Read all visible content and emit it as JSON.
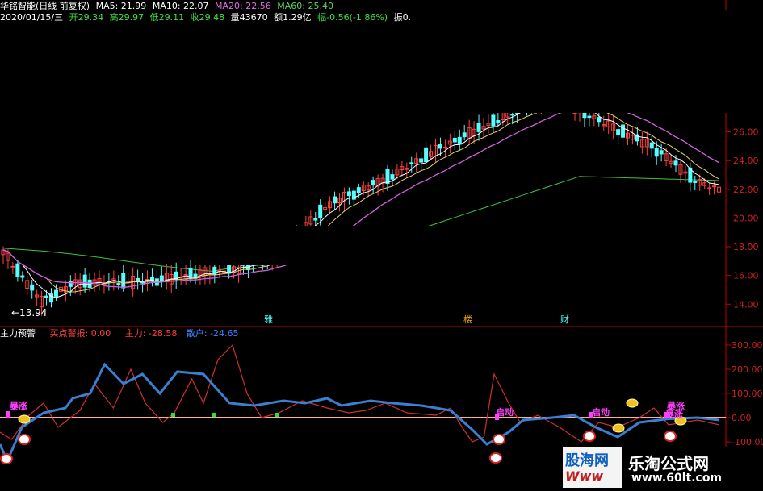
{
  "header": {
    "title": "华铭智能(日线 前复权)",
    "ma5": "MA5: 21.99",
    "ma10": "MA10: 22.07",
    "ma20": "MA20: 22.56",
    "ma60": "MA60: 25.40",
    "date": "2020/01/15/三",
    "open": "开29.34",
    "high": "高29.97",
    "low": "低29.11",
    "close": "收29.48",
    "volume": "量43670",
    "amount": "额1.29亿",
    "change": "幅-0.56(-1.86%)",
    "amplitude": "振0."
  },
  "price_axis": {
    "ticks": [
      "26.00",
      "24.00",
      "22.00",
      "20.00",
      "18.00",
      "16.00",
      "14.00"
    ]
  },
  "low_marker": "←13.94",
  "event_markers": [
    "雅",
    "楼",
    "财"
  ],
  "indicator": {
    "title": "主力预警",
    "buy_alert": "买点警报: 0.00",
    "main_force": "主力: -28.58",
    "retail": "散户: -24.65",
    "ticks": [
      "300.00",
      "200.00",
      "100.00",
      "0.00",
      "-100.00"
    ],
    "labels": [
      "暴涨",
      "启动",
      "启动",
      "暴涨",
      "暴涨"
    ]
  },
  "watermark": {
    "left_text": "股海网",
    "left_sub": "Www",
    "title": "乐淘公式网",
    "url": "www.60lt.com"
  },
  "colors": {
    "bg": "#000000",
    "up": "#ff4040",
    "down": "#54ffff",
    "ma5": "#ffffff",
    "ma10": "#e8d070",
    "ma20": "#d060e0",
    "ma60": "#40c040",
    "main_force": "#d03030",
    "retail": "#3a7fd0",
    "axis": "#c00000"
  },
  "chart_data": [
    {
      "type": "candlestick",
      "title": "华铭智能(日线 前复权)",
      "ylim": [
        13,
        28
      ],
      "y_ticks": [
        14,
        16,
        18,
        20,
        22,
        24,
        26
      ],
      "note_low": 13.94,
      "series": [
        {
          "name": "MA5",
          "last": 21.99
        },
        {
          "name": "MA10",
          "last": 22.07
        },
        {
          "name": "MA20",
          "last": 22.56
        },
        {
          "name": "MA60",
          "last": 25.4
        }
      ]
    },
    {
      "type": "line",
      "title": "主力预警",
      "ylim": [
        -150,
        330
      ],
      "y_ticks": [
        300,
        200,
        100,
        0,
        -100
      ],
      "series": [
        {
          "name": "主力",
          "last": -28.58
        },
        {
          "name": "散户",
          "last": -24.65
        }
      ]
    }
  ]
}
